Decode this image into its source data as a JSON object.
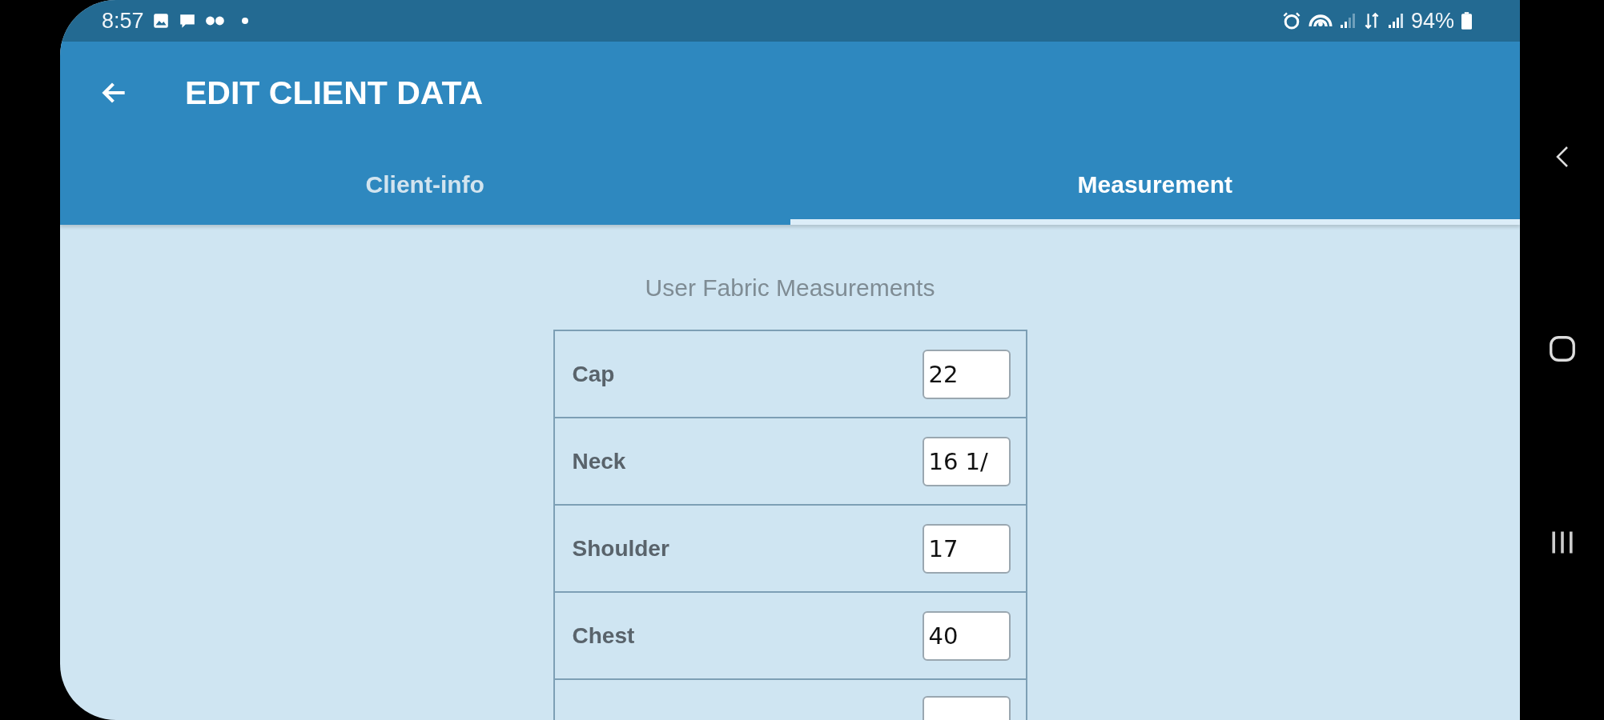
{
  "status_bar": {
    "time": "8:57",
    "battery": "94%"
  },
  "app_bar": {
    "title": "EDIT CLIENT DATA"
  },
  "tabs": [
    {
      "label": "Client-info",
      "selected": false
    },
    {
      "label": "Measurement",
      "selected": true
    }
  ],
  "section_title": "User Fabric Measurements",
  "measurements": [
    {
      "label": "Cap",
      "value": "22"
    },
    {
      "label": "Neck",
      "value": "16 1/"
    },
    {
      "label": "Shoulder",
      "value": "17"
    },
    {
      "label": "Chest",
      "value": "40"
    }
  ]
}
